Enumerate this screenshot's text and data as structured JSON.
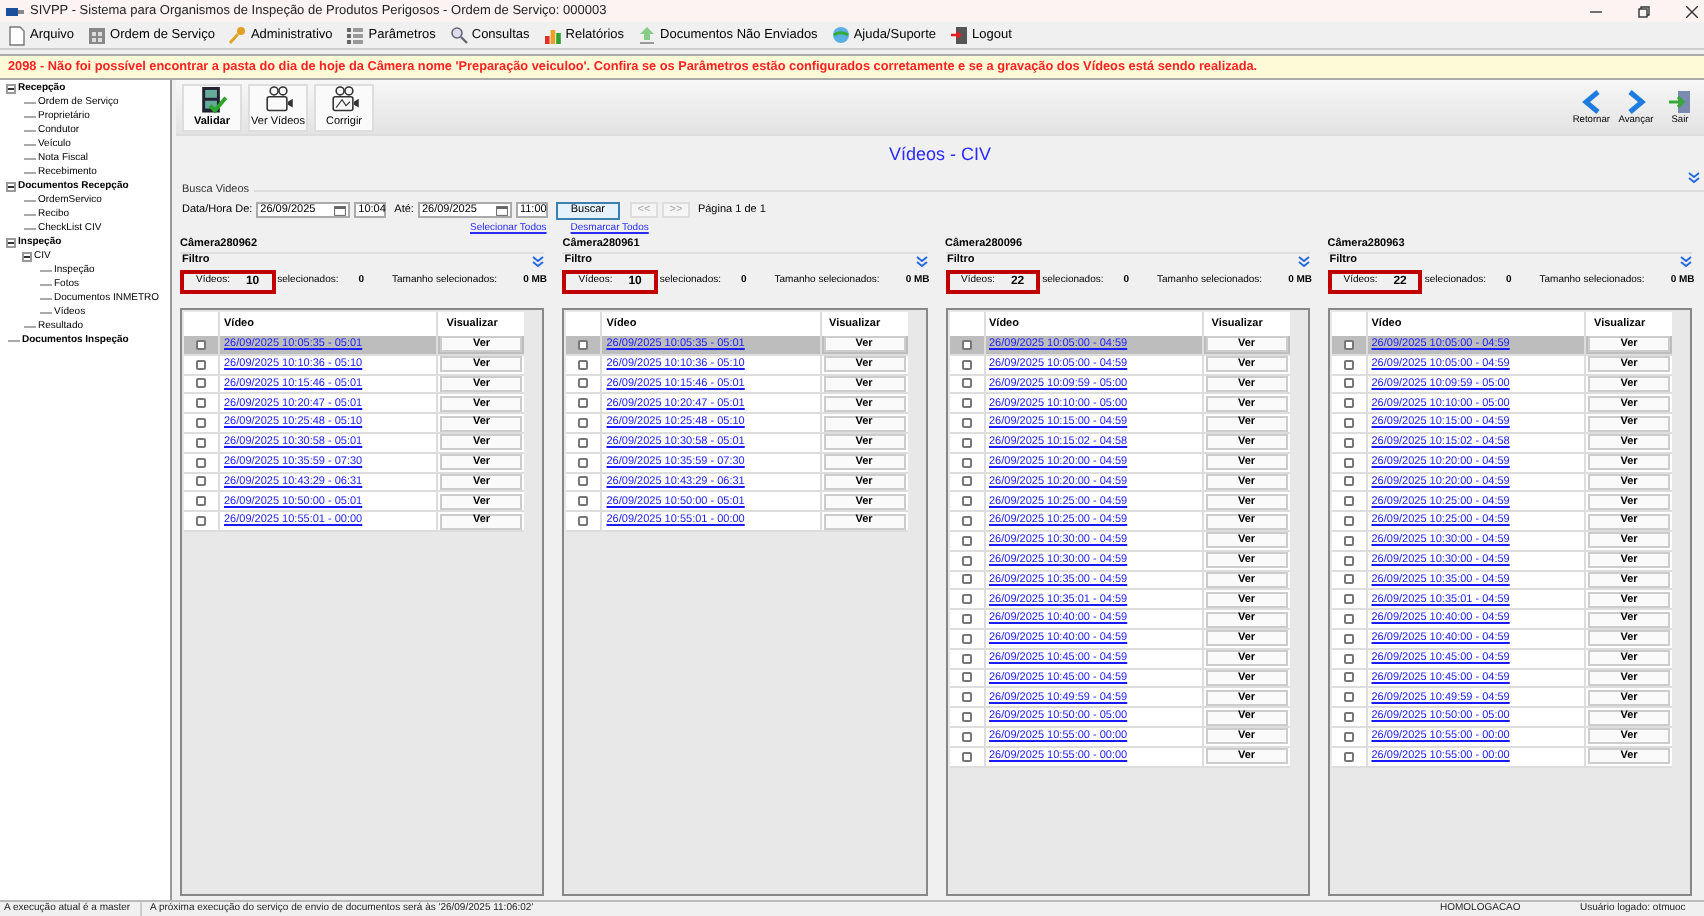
{
  "window": {
    "title": "SIVPP - Sistema para Organismos de Inspeção de Produtos Perigosos - Ordem de Serviço: 000003"
  },
  "menu": [
    "Arquivo",
    "Ordem de Serviço",
    "Administrativo",
    "Parâmetros",
    "Consultas",
    "Relatórios",
    "Documentos Não Enviados",
    "Ajuda/Suporte",
    "Logout"
  ],
  "warning": "2098 - Não foi possível encontrar a pasta do dia de hoje da Câmera nome 'Preparação veiculoo'. Confira se os Parâmetros estão configurados corretamente e se a gravação dos Vídeos está sendo realizada.",
  "sidebar": [
    {
      "label": "Recepção",
      "expanded": true,
      "children": [
        {
          "label": "Ordem de Serviço"
        },
        {
          "label": "Proprietário"
        },
        {
          "label": "Condutor"
        },
        {
          "label": "Veículo"
        },
        {
          "label": "Nota Fiscal"
        },
        {
          "label": "Recebimento"
        }
      ]
    },
    {
      "label": "Documentos Recepção",
      "expanded": true,
      "children": [
        {
          "label": "OrdemServico"
        },
        {
          "label": "Recibo"
        },
        {
          "label": "CheckList CIV"
        }
      ]
    },
    {
      "label": "Inspeção",
      "expanded": true,
      "children": [
        {
          "label": "CIV",
          "expanded": true,
          "children": [
            {
              "label": "Inspeção"
            },
            {
              "label": "Fotos"
            },
            {
              "label": "Documentos INMETRO"
            },
            {
              "label": "Vídeos"
            }
          ]
        },
        {
          "label": "Resultado"
        }
      ]
    },
    {
      "label": "Documentos Inspeção"
    }
  ],
  "toolbar_left": [
    "Validar",
    "Ver Vídeos",
    "Corrigir"
  ],
  "toolbar_right": [
    "Retornar",
    "Avançar",
    "Sair"
  ],
  "page_title": "Vídeos - CIV",
  "search": {
    "legend": "Busca Videos",
    "from_label": "Data/Hora De:",
    "from_date": "26/09/2025",
    "from_time": "10:04",
    "to_label": "Até:",
    "to_date": "26/09/2025",
    "to_time": "11:00",
    "search_button": "Buscar",
    "prev": "<<",
    "next": ">>",
    "page": "Página 1 de 1",
    "select_all": "Selecionar Todos",
    "deselect_all": "Desmarcar Todos"
  },
  "cameras": [
    {
      "name": "Câmera280962",
      "filter": "Filtro",
      "videos_label": "Vídeos:",
      "videos_count": "10",
      "selected_label": "selecionados:",
      "selected_count": "0",
      "size_label": "Tamanho selecionados:",
      "size": "0 MB",
      "col_video": "Vídeo",
      "col_view": "Visualizar",
      "rows": [
        {
          "video": "26/09/2025 10:05:35 - 05:01",
          "view": "Ver",
          "checked": false,
          "selected": true
        },
        {
          "video": "26/09/2025 10:10:36 - 05:10",
          "view": "Ver",
          "checked": false,
          "selected": false
        },
        {
          "video": "26/09/2025 10:15:46 - 05:01",
          "view": "Ver",
          "checked": false,
          "selected": false
        },
        {
          "video": "26/09/2025 10:20:47 - 05:01",
          "view": "Ver",
          "checked": false,
          "selected": false
        },
        {
          "video": "26/09/2025 10:25:48 - 05:10",
          "view": "Ver",
          "checked": false,
          "selected": false
        },
        {
          "video": "26/09/2025 10:30:58 - 05:01",
          "view": "Ver",
          "checked": false,
          "selected": false
        },
        {
          "video": "26/09/2025 10:35:59 - 07:30",
          "view": "Ver",
          "checked": false,
          "selected": false
        },
        {
          "video": "26/09/2025 10:43:29 - 06:31",
          "view": "Ver",
          "checked": false,
          "selected": false
        },
        {
          "video": "26/09/2025 10:50:00 - 05:01",
          "view": "Ver",
          "checked": false,
          "selected": false
        },
        {
          "video": "26/09/2025 10:55:01 - 00:00",
          "view": "Ver",
          "checked": false,
          "selected": false
        }
      ]
    },
    {
      "name": "Câmera280961",
      "filter": "Filtro",
      "videos_label": "Vídeos:",
      "videos_count": "10",
      "selected_label": "selecionados:",
      "selected_count": "0",
      "size_label": "Tamanho selecionados:",
      "size": "0 MB",
      "col_video": "Vídeo",
      "col_view": "Visualizar",
      "rows": [
        {
          "video": "26/09/2025 10:05:35 - 05:01",
          "view": "Ver",
          "checked": false,
          "selected": true
        },
        {
          "video": "26/09/2025 10:10:36 - 05:10",
          "view": "Ver",
          "checked": false,
          "selected": false
        },
        {
          "video": "26/09/2025 10:15:46 - 05:01",
          "view": "Ver",
          "checked": false,
          "selected": false
        },
        {
          "video": "26/09/2025 10:20:47 - 05:01",
          "view": "Ver",
          "checked": false,
          "selected": false
        },
        {
          "video": "26/09/2025 10:25:48 - 05:10",
          "view": "Ver",
          "checked": false,
          "selected": false
        },
        {
          "video": "26/09/2025 10:30:58 - 05:01",
          "view": "Ver",
          "checked": false,
          "selected": false
        },
        {
          "video": "26/09/2025 10:35:59 - 07:30",
          "view": "Ver",
          "checked": false,
          "selected": false
        },
        {
          "video": "26/09/2025 10:43:29 - 06:31",
          "view": "Ver",
          "checked": false,
          "selected": false
        },
        {
          "video": "26/09/2025 10:50:00 - 05:01",
          "view": "Ver",
          "checked": false,
          "selected": false
        },
        {
          "video": "26/09/2025 10:55:01 - 00:00",
          "view": "Ver",
          "checked": false,
          "selected": false
        }
      ]
    },
    {
      "name": "Câmera280096",
      "filter": "Filtro",
      "videos_label": "Vídeos:",
      "videos_count": "22",
      "selected_label": "selecionados:",
      "selected_count": "0",
      "size_label": "Tamanho selecionados:",
      "size": "0 MB",
      "col_video": "Vídeo",
      "col_view": "Visualizar",
      "rows": [
        {
          "video": "26/09/2025 10:05:00 - 04:59",
          "view": "Ver",
          "checked": false,
          "selected": true
        },
        {
          "video": "26/09/2025 10:05:00 - 04:59",
          "view": "Ver",
          "checked": false,
          "selected": false
        },
        {
          "video": "26/09/2025 10:09:59 - 05:00",
          "view": "Ver",
          "checked": false,
          "selected": false
        },
        {
          "video": "26/09/2025 10:10:00 - 05:00",
          "view": "Ver",
          "checked": false,
          "selected": false
        },
        {
          "video": "26/09/2025 10:15:00 - 04:59",
          "view": "Ver",
          "checked": false,
          "selected": false
        },
        {
          "video": "26/09/2025 10:15:02 - 04:58",
          "view": "Ver",
          "checked": false,
          "selected": false
        },
        {
          "video": "26/09/2025 10:20:00 - 04:59",
          "view": "Ver",
          "checked": false,
          "selected": false
        },
        {
          "video": "26/09/2025 10:20:00 - 04:59",
          "view": "Ver",
          "checked": false,
          "selected": false
        },
        {
          "video": "26/09/2025 10:25:00 - 04:59",
          "view": "Ver",
          "checked": false,
          "selected": false
        },
        {
          "video": "26/09/2025 10:25:00 - 04:59",
          "view": "Ver",
          "checked": false,
          "selected": false
        },
        {
          "video": "26/09/2025 10:30:00 - 04:59",
          "view": "Ver",
          "checked": false,
          "selected": false
        },
        {
          "video": "26/09/2025 10:30:00 - 04:59",
          "view": "Ver",
          "checked": false,
          "selected": false
        },
        {
          "video": "26/09/2025 10:35:00 - 04:59",
          "view": "Ver",
          "checked": false,
          "selected": false
        },
        {
          "video": "26/09/2025 10:35:01 - 04:59",
          "view": "Ver",
          "checked": false,
          "selected": false
        },
        {
          "video": "26/09/2025 10:40:00 - 04:59",
          "view": "Ver",
          "checked": false,
          "selected": false
        },
        {
          "video": "26/09/2025 10:40:00 - 04:59",
          "view": "Ver",
          "checked": false,
          "selected": false
        },
        {
          "video": "26/09/2025 10:45:00 - 04:59",
          "view": "Ver",
          "checked": false,
          "selected": false
        },
        {
          "video": "26/09/2025 10:45:00 - 04:59",
          "view": "Ver",
          "checked": false,
          "selected": false
        },
        {
          "video": "26/09/2025 10:49:59 - 04:59",
          "view": "Ver",
          "checked": false,
          "selected": false
        },
        {
          "video": "26/09/2025 10:50:00 - 05:00",
          "view": "Ver",
          "checked": false,
          "selected": false
        },
        {
          "video": "26/09/2025 10:55:00 - 00:00",
          "view": "Ver",
          "checked": false,
          "selected": false
        },
        {
          "video": "26/09/2025 10:55:00 - 00:00",
          "view": "Ver",
          "checked": false,
          "selected": false
        }
      ]
    },
    {
      "name": "Câmera280963",
      "filter": "Filtro",
      "videos_label": "Vídeos:",
      "videos_count": "22",
      "selected_label": "selecionados:",
      "selected_count": "0",
      "size_label": "Tamanho selecionados:",
      "size": "0 MB",
      "col_video": "Vídeo",
      "col_view": "Visualizar",
      "rows": [
        {
          "video": "26/09/2025 10:05:00 - 04:59",
          "view": "Ver",
          "checked": false,
          "selected": true
        },
        {
          "video": "26/09/2025 10:05:00 - 04:59",
          "view": "Ver",
          "checked": false,
          "selected": false
        },
        {
          "video": "26/09/2025 10:09:59 - 05:00",
          "view": "Ver",
          "checked": false,
          "selected": false
        },
        {
          "video": "26/09/2025 10:10:00 - 05:00",
          "view": "Ver",
          "checked": false,
          "selected": false
        },
        {
          "video": "26/09/2025 10:15:00 - 04:59",
          "view": "Ver",
          "checked": false,
          "selected": false
        },
        {
          "video": "26/09/2025 10:15:02 - 04:58",
          "view": "Ver",
          "checked": false,
          "selected": false
        },
        {
          "video": "26/09/2025 10:20:00 - 04:59",
          "view": "Ver",
          "checked": false,
          "selected": false
        },
        {
          "video": "26/09/2025 10:20:00 - 04:59",
          "view": "Ver",
          "checked": false,
          "selected": false
        },
        {
          "video": "26/09/2025 10:25:00 - 04:59",
          "view": "Ver",
          "checked": false,
          "selected": false
        },
        {
          "video": "26/09/2025 10:25:00 - 04:59",
          "view": "Ver",
          "checked": false,
          "selected": false
        },
        {
          "video": "26/09/2025 10:30:00 - 04:59",
          "view": "Ver",
          "checked": false,
          "selected": false
        },
        {
          "video": "26/09/2025 10:30:00 - 04:59",
          "view": "Ver",
          "checked": false,
          "selected": false
        },
        {
          "video": "26/09/2025 10:35:00 - 04:59",
          "view": "Ver",
          "checked": false,
          "selected": false
        },
        {
          "video": "26/09/2025 10:35:01 - 04:59",
          "view": "Ver",
          "checked": false,
          "selected": false
        },
        {
          "video": "26/09/2025 10:40:00 - 04:59",
          "view": "Ver",
          "checked": false,
          "selected": false
        },
        {
          "video": "26/09/2025 10:40:00 - 04:59",
          "view": "Ver",
          "checked": false,
          "selected": false
        },
        {
          "video": "26/09/2025 10:45:00 - 04:59",
          "view": "Ver",
          "checked": false,
          "selected": false
        },
        {
          "video": "26/09/2025 10:45:00 - 04:59",
          "view": "Ver",
          "checked": false,
          "selected": false
        },
        {
          "video": "26/09/2025 10:49:59 - 04:59",
          "view": "Ver",
          "checked": false,
          "selected": false
        },
        {
          "video": "26/09/2025 10:50:00 - 05:00",
          "view": "Ver",
          "checked": false,
          "selected": false
        },
        {
          "video": "26/09/2025 10:55:00 - 00:00",
          "view": "Ver",
          "checked": false,
          "selected": false
        },
        {
          "video": "26/09/2025 10:55:00 - 00:00",
          "view": "Ver",
          "checked": false,
          "selected": false
        }
      ]
    }
  ],
  "status_bar": [
    "A execução atual é a master",
    "A próxima execução do serviço de envio de documentos será às '26/09/2025 11:06:02'",
    "HOMOLOGACAO",
    "Usuário logado: otmuoc"
  ]
}
